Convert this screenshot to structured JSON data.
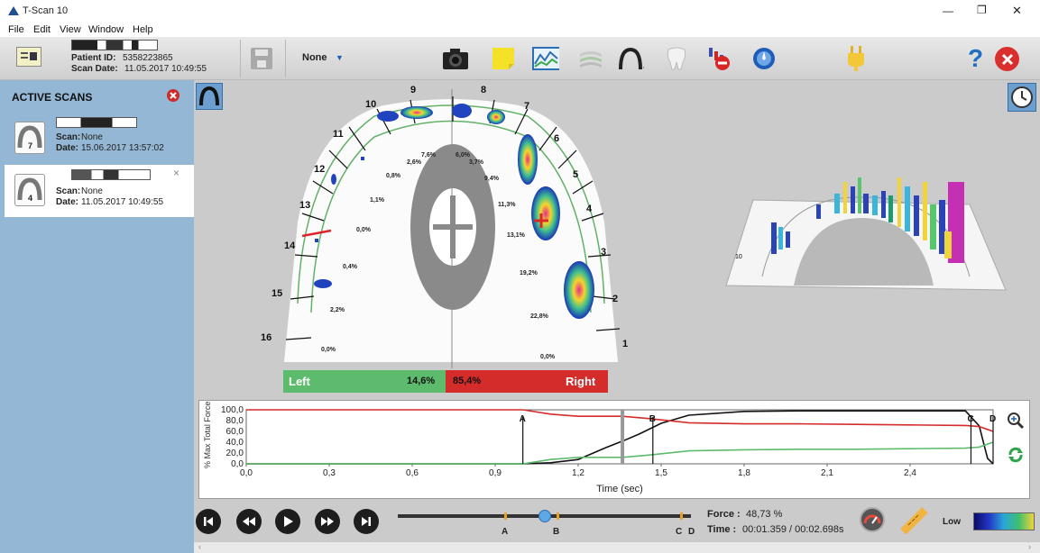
{
  "app": {
    "title": "T-Scan 10"
  },
  "window_controls": {
    "minimize": "—",
    "restore": "❐",
    "close": "✕"
  },
  "menu": {
    "items": [
      "File",
      "Edit",
      "View",
      "Window",
      "Help"
    ]
  },
  "patient": {
    "id_label": "Patient ID:",
    "id_value": "5358223865",
    "date_label": "Scan Date:",
    "date_value": "11.05.2017 10:49:55"
  },
  "toolbar": {
    "dropdown_value": "None",
    "dropdown_caret": "▼",
    "help_label": "?",
    "icons": [
      "camera-icon",
      "sticky-note-icon",
      "graph-icon",
      "layers-icon",
      "arch-icon",
      "tooth-icon",
      "no-marker-icon",
      "compass-icon",
      "plug-icon"
    ]
  },
  "sidebar": {
    "header": "ACTIVE SCANS",
    "scans": [
      {
        "number": "7",
        "scan_label": "Scan:",
        "scan_value": "None",
        "date_label": "Date:",
        "date_value": "15.06.2017 13:57:02",
        "selected": false
      },
      {
        "number": "4",
        "scan_label": "Scan:",
        "scan_value": "None",
        "date_label": "Date:",
        "date_value": "11.05.2017 10:49:55",
        "selected": true
      }
    ],
    "close_glyph": "×"
  },
  "arch": {
    "tooth_numbers": [
      "1",
      "2",
      "3",
      "4",
      "5",
      "6",
      "7",
      "8",
      "9",
      "10",
      "11",
      "12",
      "13",
      "14",
      "15",
      "16"
    ],
    "percentages": {
      "p1": "0,0%",
      "p2": "22,8%",
      "p3": "19,2%",
      "p4": "13,1%",
      "p5": "11,3%",
      "p6": "9,4%",
      "p7": "3,7%",
      "p8": "6,0%",
      "p9": "7,6%",
      "p10": "2,6%",
      "p11": "0,8%",
      "p12": "1,1%",
      "p13": "0,0%",
      "p14": "0,4%",
      "p15": "2,2%",
      "p16": "0,0%"
    },
    "left_label": "Left",
    "left_value": "14,6%",
    "right_label": "Right",
    "right_value": "85,4%",
    "left_color": "#5cbb6c",
    "right_color": "#d42b2b"
  },
  "chart_data": {
    "type": "line",
    "ylabel": "% Max Total Force",
    "xlabel": "Time (sec)",
    "ylim": [
      0,
      100
    ],
    "xlim": [
      0,
      2.7
    ],
    "yticks": [
      "100,0",
      "80,0",
      "60,0",
      "40,0",
      "20,0",
      "0,0"
    ],
    "ytick_values": [
      100,
      80,
      60,
      40,
      20,
      0
    ],
    "xticks": [
      "0,0",
      "0,3",
      "0,6",
      "0,9",
      "1,2",
      "1,5",
      "1,8",
      "2,1",
      "2,4"
    ],
    "xtick_values": [
      0,
      0.3,
      0.6,
      0.9,
      1.2,
      1.5,
      1.8,
      2.1,
      2.4
    ],
    "series": [
      {
        "color": "#111111",
        "x": [
          0,
          1.0,
          1.1,
          1.2,
          1.3,
          1.36,
          1.42,
          1.5,
          1.6,
          1.8,
          2.0,
          2.2,
          2.4,
          2.6,
          2.65,
          2.68,
          2.7
        ],
        "y": [
          0,
          0,
          2,
          8,
          30,
          42,
          55,
          75,
          90,
          97,
          98,
          98,
          98,
          98,
          70,
          10,
          0
        ]
      },
      {
        "color": "#d42b2b",
        "x": [
          0,
          0.9,
          1.0,
          1.1,
          1.2,
          1.36,
          1.45,
          1.6,
          1.8,
          2.0,
          2.2,
          2.4,
          2.6,
          2.65,
          2.7
        ],
        "y": [
          100,
          100,
          100,
          92,
          88,
          88,
          84,
          76,
          74,
          74,
          73,
          72,
          71,
          69,
          60
        ]
      },
      {
        "color": "#5cbb6c",
        "x": [
          0,
          1.0,
          1.1,
          1.2,
          1.36,
          1.45,
          1.6,
          1.8,
          2.0,
          2.2,
          2.4,
          2.6,
          2.65,
          2.7
        ],
        "y": [
          0,
          0,
          8,
          12,
          12,
          16,
          24,
          26,
          27,
          27,
          28,
          29,
          31,
          40
        ]
      }
    ],
    "markers": [
      {
        "label": "A",
        "x": 1.0
      },
      {
        "label": "B",
        "x": 1.47
      },
      {
        "label": "C",
        "x": 2.62
      },
      {
        "label": "D",
        "x": 2.7
      }
    ],
    "cursor_x": 1.36
  },
  "playback": {
    "force_label": "Force :",
    "force_value": "48,73 %",
    "time_label": "Time :",
    "time_value": "00:01.359 / 00:02.698s",
    "markers": [
      "A",
      "B",
      "C",
      "D"
    ],
    "legend_low": "Low",
    "slider_position": 0.5
  }
}
